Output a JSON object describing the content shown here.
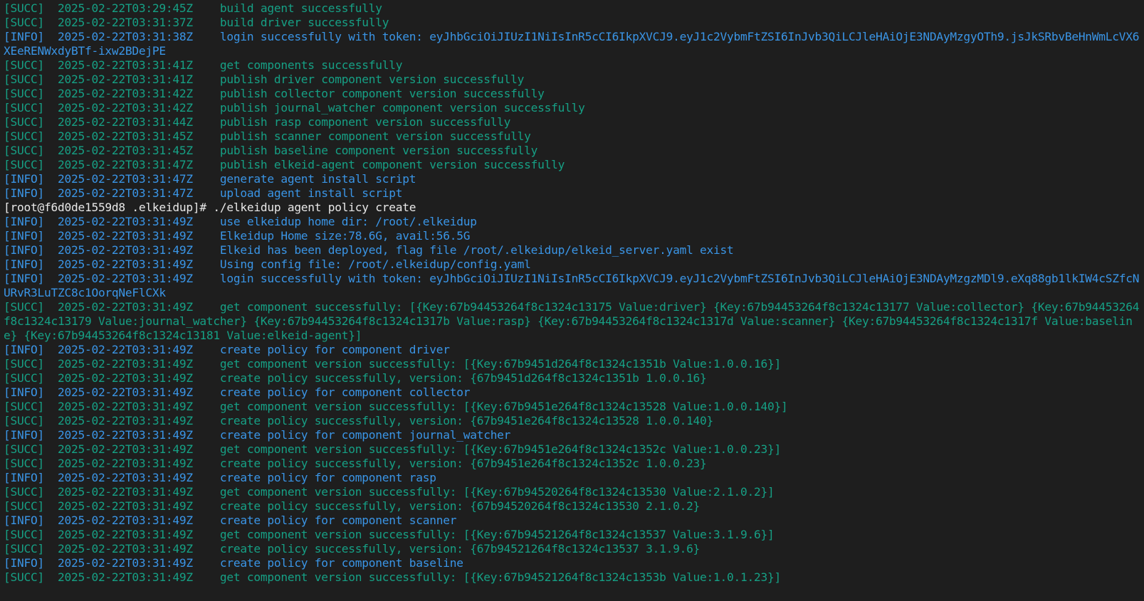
{
  "colors": {
    "background": "#1e1e1e",
    "succ": "#16a085",
    "info": "#3a95e6",
    "prompt": "#e8e8e8"
  },
  "lines": [
    {
      "kind": "succ",
      "text": "[SUCC]  2025-02-22T03:29:45Z    build agent successfully"
    },
    {
      "kind": "succ",
      "text": "[SUCC]  2025-02-22T03:31:37Z    build driver successfully"
    },
    {
      "kind": "info",
      "text": "[INFO]  2025-02-22T03:31:38Z    login successfully with token: eyJhbGciOiJIUzI1NiIsInR5cCI6IkpXVCJ9.eyJ1c2VybmFtZSI6InJvb3QiLCJleHAiOjE3NDAyMzgyOTh9.jsJkSRbvBeHnWmLcVX6XEeRENWxdyBTf-ixw2BDejPE"
    },
    {
      "kind": "succ",
      "text": "[SUCC]  2025-02-22T03:31:41Z    get components successfully"
    },
    {
      "kind": "succ",
      "text": "[SUCC]  2025-02-22T03:31:41Z    publish driver component version successfully"
    },
    {
      "kind": "succ",
      "text": "[SUCC]  2025-02-22T03:31:42Z    publish collector component version successfully"
    },
    {
      "kind": "succ",
      "text": "[SUCC]  2025-02-22T03:31:42Z    publish journal_watcher component version successfully"
    },
    {
      "kind": "succ",
      "text": "[SUCC]  2025-02-22T03:31:44Z    publish rasp component version successfully"
    },
    {
      "kind": "succ",
      "text": "[SUCC]  2025-02-22T03:31:45Z    publish scanner component version successfully"
    },
    {
      "kind": "succ",
      "text": "[SUCC]  2025-02-22T03:31:45Z    publish baseline component version successfully"
    },
    {
      "kind": "succ",
      "text": "[SUCC]  2025-02-22T03:31:47Z    publish elkeid-agent component version successfully"
    },
    {
      "kind": "info",
      "text": "[INFO]  2025-02-22T03:31:47Z    generate agent install script"
    },
    {
      "kind": "info",
      "text": "[INFO]  2025-02-22T03:31:47Z    upload agent install script"
    },
    {
      "kind": "prompt",
      "text": "[root@f6d0de1559d8 .elkeidup]# ./elkeidup agent policy create"
    },
    {
      "kind": "info",
      "text": "[INFO]  2025-02-22T03:31:49Z    use elkeidup home dir: /root/.elkeidup"
    },
    {
      "kind": "info",
      "text": "[INFO]  2025-02-22T03:31:49Z    Elkeidup Home size:78.6G, avail:56.5G"
    },
    {
      "kind": "info",
      "text": "[INFO]  2025-02-22T03:31:49Z    Elkeid has been deployed, flag file /root/.elkeidup/elkeid_server.yaml exist"
    },
    {
      "kind": "info",
      "text": "[INFO]  2025-02-22T03:31:49Z    Using config file: /root/.elkeidup/config.yaml"
    },
    {
      "kind": "info",
      "text": "[INFO]  2025-02-22T03:31:49Z    login successfully with token: eyJhbGciOiJIUzI1NiIsInR5cCI6IkpXVCJ9.eyJ1c2VybmFtZSI6InJvb3QiLCJleHAiOjE3NDAyMzgzMDl9.eXq88gb1lkIW4cSZfcNURvR3LuTZC8c1OorqNeFlCXk"
    },
    {
      "kind": "succ",
      "text": "[SUCC]  2025-02-22T03:31:49Z    get component successfully: [{Key:67b94453264f8c1324c13175 Value:driver} {Key:67b94453264f8c1324c13177 Value:collector} {Key:67b94453264f8c1324c13179 Value:journal_watcher} {Key:67b94453264f8c1324c1317b Value:rasp} {Key:67b94453264f8c1324c1317d Value:scanner} {Key:67b94453264f8c1324c1317f Value:baseline} {Key:67b94453264f8c1324c13181 Value:elkeid-agent}]"
    },
    {
      "kind": "info",
      "text": "[INFO]  2025-02-22T03:31:49Z    create policy for component driver"
    },
    {
      "kind": "succ",
      "text": "[SUCC]  2025-02-22T03:31:49Z    get component version successfully: [{Key:67b9451d264f8c1324c1351b Value:1.0.0.16}]"
    },
    {
      "kind": "succ",
      "text": "[SUCC]  2025-02-22T03:31:49Z    create policy successfully, version: {67b9451d264f8c1324c1351b 1.0.0.16}"
    },
    {
      "kind": "info",
      "text": "[INFO]  2025-02-22T03:31:49Z    create policy for component collector"
    },
    {
      "kind": "succ",
      "text": "[SUCC]  2025-02-22T03:31:49Z    get component version successfully: [{Key:67b9451e264f8c1324c13528 Value:1.0.0.140}]"
    },
    {
      "kind": "succ",
      "text": "[SUCC]  2025-02-22T03:31:49Z    create policy successfully, version: {67b9451e264f8c1324c13528 1.0.0.140}"
    },
    {
      "kind": "info",
      "text": "[INFO]  2025-02-22T03:31:49Z    create policy for component journal_watcher"
    },
    {
      "kind": "succ",
      "text": "[SUCC]  2025-02-22T03:31:49Z    get component version successfully: [{Key:67b9451e264f8c1324c1352c Value:1.0.0.23}]"
    },
    {
      "kind": "succ",
      "text": "[SUCC]  2025-02-22T03:31:49Z    create policy successfully, version: {67b9451e264f8c1324c1352c 1.0.0.23}"
    },
    {
      "kind": "info",
      "text": "[INFO]  2025-02-22T03:31:49Z    create policy for component rasp"
    },
    {
      "kind": "succ",
      "text": "[SUCC]  2025-02-22T03:31:49Z    get component version successfully: [{Key:67b94520264f8c1324c13530 Value:2.1.0.2}]"
    },
    {
      "kind": "succ",
      "text": "[SUCC]  2025-02-22T03:31:49Z    create policy successfully, version: {67b94520264f8c1324c13530 2.1.0.2}"
    },
    {
      "kind": "info",
      "text": "[INFO]  2025-02-22T03:31:49Z    create policy for component scanner"
    },
    {
      "kind": "succ",
      "text": "[SUCC]  2025-02-22T03:31:49Z    get component version successfully: [{Key:67b94521264f8c1324c13537 Value:3.1.9.6}]"
    },
    {
      "kind": "succ",
      "text": "[SUCC]  2025-02-22T03:31:49Z    create policy successfully, version: {67b94521264f8c1324c13537 3.1.9.6}"
    },
    {
      "kind": "info",
      "text": "[INFO]  2025-02-22T03:31:49Z    create policy for component baseline"
    },
    {
      "kind": "succ",
      "text": "[SUCC]  2025-02-22T03:31:49Z    get component version successfully: [{Key:67b94521264f8c1324c1353b Value:1.0.1.23}]"
    }
  ]
}
